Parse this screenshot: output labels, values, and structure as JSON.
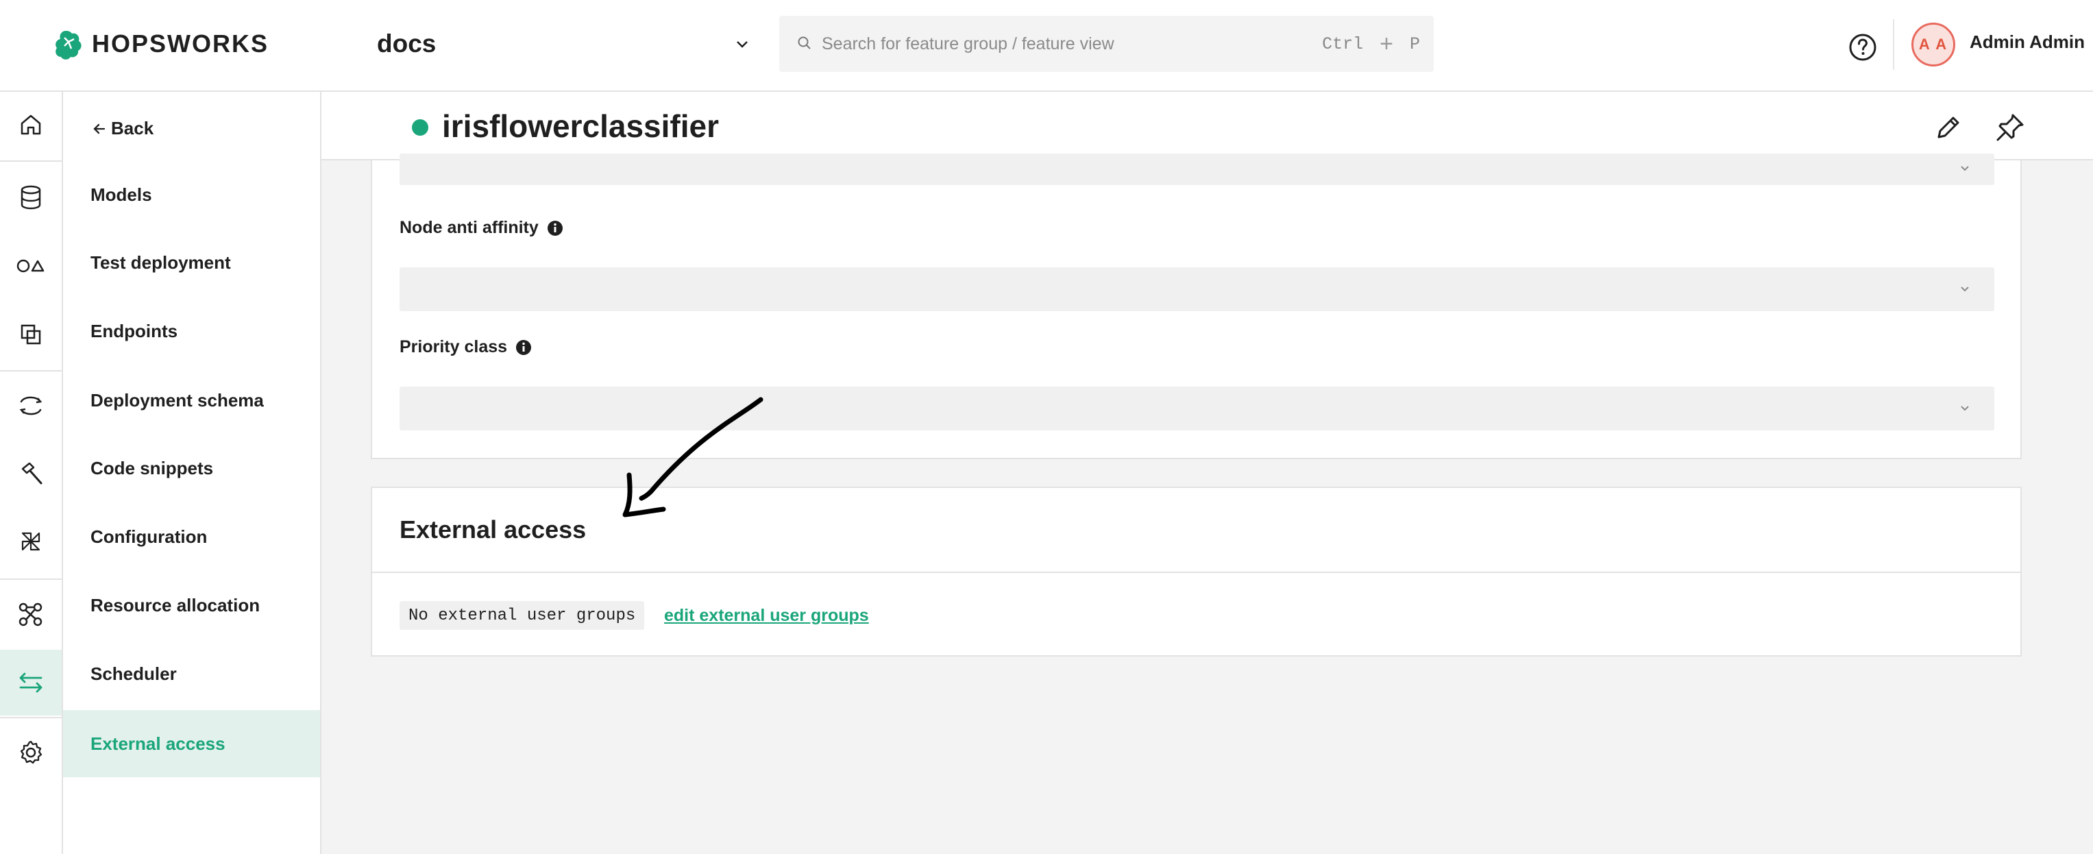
{
  "brand": {
    "name": "HOPSWORKS",
    "accent": "#1aa57a"
  },
  "header": {
    "project": "docs",
    "search_placeholder": "Search for feature group / feature view",
    "shortcut_ctrl": "Ctrl",
    "shortcut_plus": "+",
    "shortcut_key": "P",
    "avatar_initials": "A A",
    "user_name": "Admin Admin"
  },
  "rail": {
    "icons": [
      "home-icon",
      "database-icon",
      "shapes-icon",
      "copy-icon",
      "loop-icon",
      "hammer-icon",
      "pinwheel-icon",
      "graph-icon",
      "arrows-exchange-icon",
      "settings-icon"
    ],
    "active": "arrows-exchange-icon"
  },
  "subnav": {
    "back_label": "Back",
    "items": [
      {
        "label": "Models"
      },
      {
        "label": "Test deployment"
      },
      {
        "label": "Endpoints"
      },
      {
        "label": "Deployment schema"
      },
      {
        "label": "Code snippets"
      },
      {
        "label": "Configuration"
      },
      {
        "label": "Resource allocation"
      },
      {
        "label": "Scheduler"
      },
      {
        "label": "External access"
      }
    ],
    "active": "External access"
  },
  "main": {
    "title": "irisflowerclassifier",
    "status_color": "#1aa57a",
    "fields": {
      "node_anti_affinity": "Node anti affinity",
      "priority_class": "Priority class"
    },
    "external_access": {
      "title": "External access",
      "groups_text": "No external user groups",
      "edit_link": "edit external user groups"
    }
  }
}
